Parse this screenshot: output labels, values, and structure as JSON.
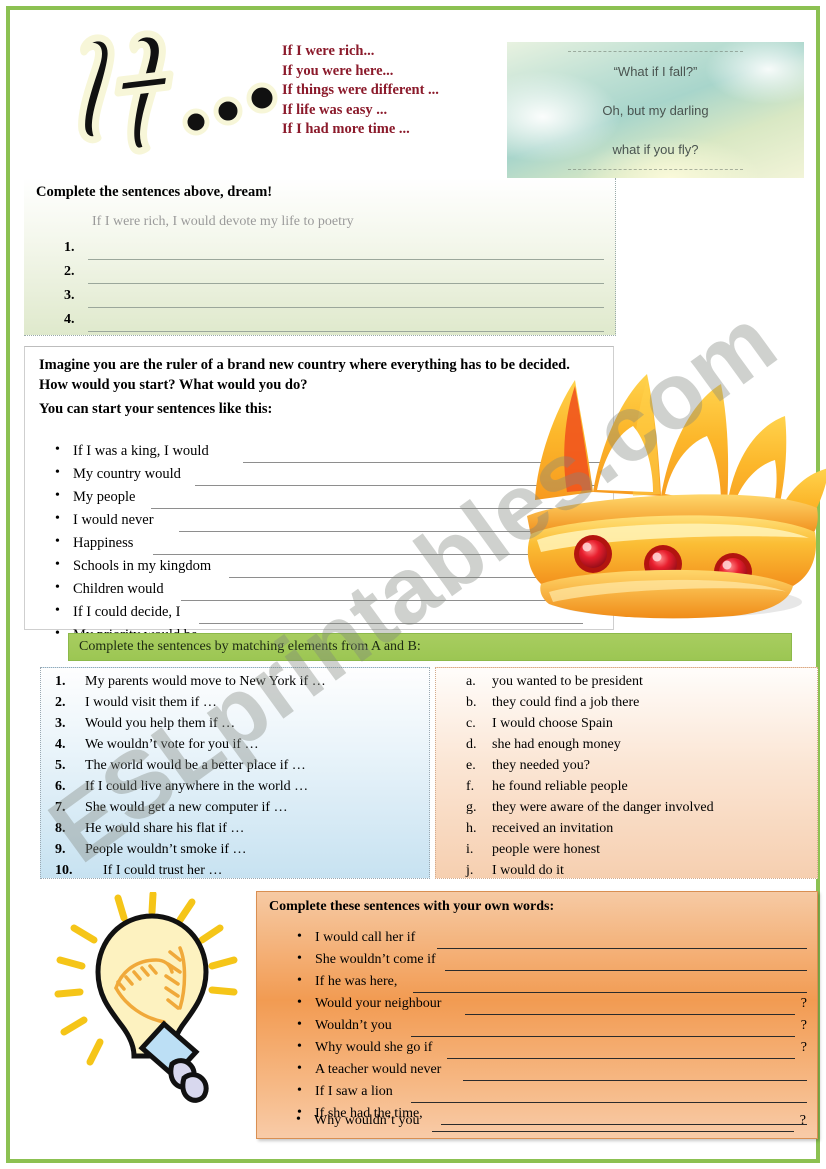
{
  "colors": {
    "page_border": "#8cc152",
    "header_red": "#8b1a2b",
    "match_header_green": "#9cc653",
    "column_a": "#c7e2f1",
    "column_b": "#f6cfb0",
    "orange_box": "#f29b52"
  },
  "watermark": "ESLprintables.com",
  "header": {
    "logo_text": "If...",
    "prompts": [
      "If I were rich...",
      "If you were here...",
      "If things were different ...",
      "If life was easy ...",
      "If I had more time ..."
    ],
    "sky_quote": {
      "line1": "“What if I fall?”",
      "line2": "Oh, but my darling",
      "line3": "what if you fly?"
    }
  },
  "section1": {
    "title": "Complete the sentences above, dream!",
    "example": "If I were rich, I would devote my life to poetry",
    "numbers": [
      "1.",
      "2.",
      "3.",
      "4."
    ]
  },
  "section2": {
    "lead": "Imagine you are the ruler of a brand new country where everything has to be decided. How would you start? What would you do?",
    "start_label": "You can start your sentences like this:",
    "items": [
      "If I was a king, I would",
      "My country would",
      "My people",
      "I would never",
      "Happiness",
      "Schools in my kingdom",
      "Children would",
      "If I could decide, I",
      "My priority would be"
    ]
  },
  "section3": {
    "title": "Complete the sentences by matching elements from A and B:",
    "column_a": [
      {
        "key": "1.",
        "text": "My parents would move to New York if …"
      },
      {
        "key": "2.",
        "text": "I would visit them if …"
      },
      {
        "key": "3.",
        "text": "Would you help them if …"
      },
      {
        "key": "4.",
        "text": "We wouldn’t vote for you if …"
      },
      {
        "key": "5.",
        "text": "The world would be a better place if …"
      },
      {
        "key": "6.",
        "text": "If I could live anywhere in the world …"
      },
      {
        "key": "7.",
        "text": "She would get a new computer if …"
      },
      {
        "key": "8.",
        "text": "He would share his flat if …"
      },
      {
        "key": "9.",
        "text": "People wouldn’t smoke if …"
      },
      {
        "key": "10.",
        "text": "If I could trust her …"
      }
    ],
    "column_b": [
      {
        "key": "a.",
        "text": "you wanted to be president"
      },
      {
        "key": "b.",
        "text": "they could find a job there"
      },
      {
        "key": "c.",
        "text": "I would choose Spain"
      },
      {
        "key": "d.",
        "text": "she had enough money"
      },
      {
        "key": "e.",
        "text": "they needed you?"
      },
      {
        "key": "f.",
        "text": "he found reliable people"
      },
      {
        "key": "g.",
        "text": "they were aware of the danger involved"
      },
      {
        "key": "h.",
        "text": "received an invitation"
      },
      {
        "key": "i.",
        "text": "people were honest"
      },
      {
        "key": "j.",
        "text": "I would do it"
      }
    ]
  },
  "section4": {
    "title": "Complete these sentences with your own words:",
    "items": [
      {
        "text": "I would call her if",
        "end": ""
      },
      {
        "text": "She wouldn’t come if",
        "end": ""
      },
      {
        "text": "If he was here,",
        "end": ""
      },
      {
        "text": "Would your neighbour",
        "end": "?"
      },
      {
        "text": "Wouldn’t you",
        "end": "?"
      },
      {
        "text": "Why would she go if",
        "end": "?"
      },
      {
        "text": "A teacher would never",
        "end": ""
      },
      {
        "text": "If I saw a lion",
        "end": ""
      },
      {
        "text": "If she had the time,",
        "end": ""
      },
      {
        "text": "Why wouldn’t you",
        "end": "?"
      }
    ]
  }
}
